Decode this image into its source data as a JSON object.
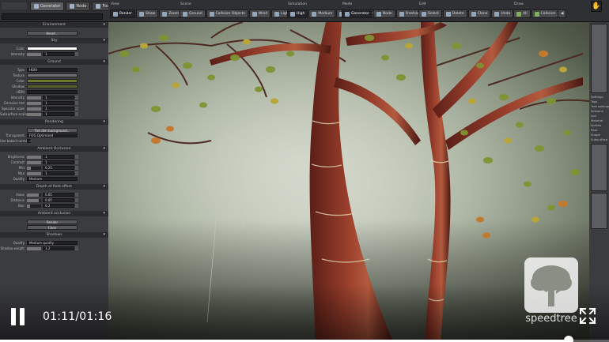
{
  "top_tabs": [
    {
      "label": "Generator",
      "active": true
    },
    {
      "label": "Node",
      "active": false
    },
    {
      "label": "Fountain",
      "active": false
    }
  ],
  "toolbar": {
    "groups": [
      {
        "label": "View",
        "buttons": [
          {
            "label": "Render",
            "active": true
          },
          {
            "label": "Show"
          },
          {
            "label": "Zoom"
          }
        ]
      },
      {
        "label": "Scene",
        "buttons": [
          {
            "label": "Ground"
          },
          {
            "label": "Collision Objects"
          },
          {
            "label": "Wind"
          },
          {
            "label": "Light"
          }
        ]
      },
      {
        "label": "Simulation",
        "buttons": [
          {
            "label": "High",
            "active": true
          },
          {
            "label": "Medium"
          },
          {
            "label": "Low"
          },
          {
            "label": "Draft"
          }
        ]
      },
      {
        "label": "Mode",
        "buttons": [
          {
            "label": "Generator",
            "active": true
          },
          {
            "label": "Node"
          },
          {
            "label": "Freehand"
          }
        ]
      },
      {
        "label": "Edit",
        "buttons": [
          {
            "label": "Select"
          },
          {
            "label": "Delete"
          },
          {
            "label": "Clone"
          },
          {
            "label": "Undo"
          }
        ]
      },
      {
        "label": "Draw",
        "buttons": [
          {
            "label": "All"
          },
          {
            "label": "Collision"
          }
        ]
      }
    ]
  },
  "left_panel": {
    "sections": [
      {
        "title": "Environment",
        "rows": [
          {
            "type": "button",
            "label": "",
            "value": "Reset..."
          }
        ]
      },
      {
        "title": "Sky",
        "rows": [
          {
            "type": "swatch",
            "label": "Color",
            "color": "#ffffff"
          },
          {
            "type": "slider",
            "label": "Intensity",
            "value": "1"
          }
        ]
      },
      {
        "title": "Ground",
        "rows": [
          {
            "type": "field",
            "label": "Type",
            "value": "HDRI"
          },
          {
            "type": "swatch",
            "label": "Texture",
            "color": "#707070"
          },
          {
            "type": "swatch",
            "label": "Color",
            "color": "#6b7a2f"
          },
          {
            "type": "swatch",
            "label": "Shadow",
            "color": "#55602a"
          },
          {
            "type": "field",
            "label": "HDRI",
            "value": ""
          },
          {
            "type": "slider",
            "label": "Intensity",
            "value": "1"
          },
          {
            "type": "slider",
            "label": "Emission tint",
            "value": "1"
          },
          {
            "type": "slider",
            "label": "Specular scale",
            "value": "1"
          },
          {
            "type": "slider",
            "label": "Subsurface scale",
            "value": "1"
          }
        ]
      },
      {
        "title": "Rendering",
        "rows": [
          {
            "type": "button",
            "label": "",
            "value": "Tint dim background..."
          },
          {
            "type": "field",
            "label": "Transparent",
            "value": "FOG Optimized"
          },
          {
            "type": "check",
            "label": "Use baked normals",
            "checked": true
          }
        ]
      },
      {
        "title": "Ambient Occlusion",
        "rows": [
          {
            "type": "slider",
            "label": "Brightness",
            "value": "1"
          },
          {
            "type": "slider",
            "label": "Contrast",
            "value": "1"
          },
          {
            "type": "slider",
            "label": "Min",
            "value": "0.25"
          },
          {
            "type": "slider",
            "label": "Max",
            "value": "1"
          },
          {
            "type": "field",
            "label": "Quality",
            "value": "Medium"
          }
        ]
      },
      {
        "title": "Depth of field effect",
        "rows": [
          {
            "type": "slider",
            "label": "Value",
            "value": "0.85"
          },
          {
            "type": "slider",
            "label": "Distance",
            "value": "0.85"
          },
          {
            "type": "slider",
            "label": "Blur",
            "value": "0.2"
          }
        ]
      },
      {
        "title": "Ambient occlusion",
        "rows": [
          {
            "type": "button",
            "label": "",
            "value": "Render"
          },
          {
            "type": "button",
            "label": "",
            "value": "Clear"
          }
        ]
      },
      {
        "title": "Shadows",
        "rows": [
          {
            "type": "field",
            "label": "Quality",
            "value": "Medium quality"
          },
          {
            "type": "slider",
            "label": "Shadow weight",
            "value": "1.2"
          }
        ]
      }
    ]
  },
  "right_panel": {
    "labels": [
      "Settings",
      "Tags",
      "Tree settings",
      "Seasons",
      "Lod",
      "Material",
      "Sprites",
      "Pass",
      "Shape",
      "Subsurface"
    ]
  },
  "video": {
    "timecode": "01:11/01:16",
    "progress": 0.934,
    "brand": "speedtree"
  },
  "colors": {
    "panel": "#3b3c3f",
    "toolbar": "#2f3033",
    "accent": "#8fa6bb",
    "bark": "#7a2e22",
    "leaf": "#8a9a2e"
  },
  "icons": {
    "pause": "pause-icon",
    "fullscreen": "fullscreen-icon",
    "hand": "hand-icon"
  }
}
